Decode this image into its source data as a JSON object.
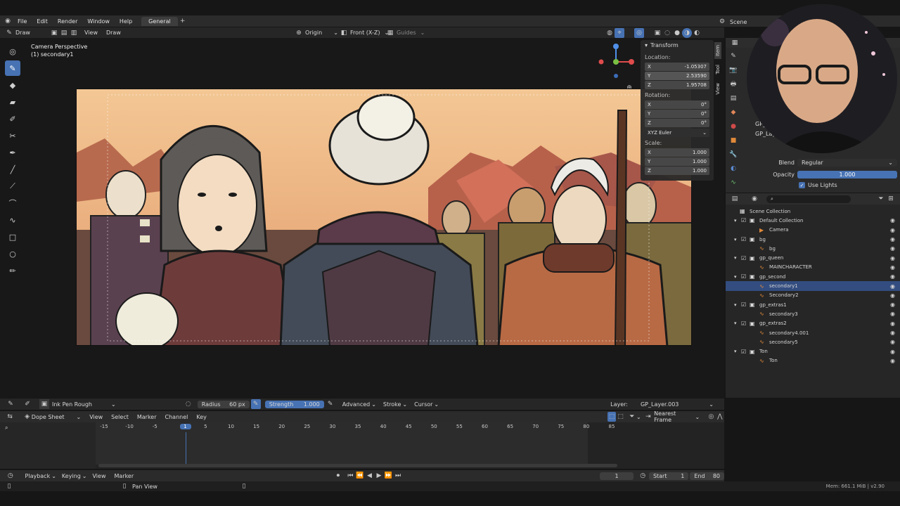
{
  "menu": {
    "items": [
      "File",
      "Edit",
      "Render",
      "Window",
      "Help"
    ],
    "workspace_tab": "General",
    "scene": "Scene"
  },
  "header": {
    "mode": "Draw",
    "view": "View",
    "draw": "Draw",
    "origin": "Origin",
    "front": "Front (X-Z)",
    "guides": "Guides"
  },
  "viewport": {
    "camera_title": "Camera Perspective",
    "object_name": "(1) secondary1"
  },
  "transform": {
    "title": "Transform",
    "location_label": "Location:",
    "loc": [
      {
        "axis": "X",
        "val": "-1.05307"
      },
      {
        "axis": "Y",
        "val": "2.53590"
      },
      {
        "axis": "Z",
        "val": "1.95708"
      }
    ],
    "rotation_label": "Rotation:",
    "rot": [
      {
        "axis": "X",
        "val": "0°"
      },
      {
        "axis": "Y",
        "val": "0°"
      },
      {
        "axis": "Z",
        "val": "0°"
      }
    ],
    "euler": "XYZ Euler",
    "scale_label": "Scale:",
    "scale": [
      {
        "axis": "X",
        "val": "1.000"
      },
      {
        "axis": "Y",
        "val": "1.000"
      },
      {
        "axis": "Z",
        "val": "1.000"
      }
    ],
    "tabs": [
      "Item",
      "Tool",
      "View"
    ]
  },
  "props": {
    "layer_short": "GP_",
    "layer_short2": "GP_Lay",
    "blend_label": "Blend",
    "blend_value": "Regular",
    "opacity_label": "Opacity",
    "opacity_value": "1.000",
    "opacity_level": 1.0,
    "use_lights": "Use Lights"
  },
  "outliner": {
    "rows": [
      {
        "label": "Scene Collection",
        "indent": 0,
        "type": "scene"
      },
      {
        "label": "Default Collection",
        "indent": 1,
        "type": "coll"
      },
      {
        "label": "Camera",
        "indent": 2,
        "type": "cam"
      },
      {
        "label": "bg",
        "indent": 1,
        "type": "coll"
      },
      {
        "label": "bg",
        "indent": 2,
        "type": "gp"
      },
      {
        "label": "gp_queen",
        "indent": 1,
        "type": "coll"
      },
      {
        "label": "MAINCHARACTER",
        "indent": 2,
        "type": "gp"
      },
      {
        "label": "gp_second",
        "indent": 1,
        "type": "coll"
      },
      {
        "label": "secondary1",
        "indent": 2,
        "type": "gp",
        "selected": true
      },
      {
        "label": "Secondary2",
        "indent": 2,
        "type": "gp"
      },
      {
        "label": "gp_extras1",
        "indent": 1,
        "type": "coll"
      },
      {
        "label": "secondary3",
        "indent": 2,
        "type": "gp"
      },
      {
        "label": "gp_extras2",
        "indent": 1,
        "type": "coll"
      },
      {
        "label": "secondary4.001",
        "indent": 2,
        "type": "gp"
      },
      {
        "label": "secondary5",
        "indent": 2,
        "type": "gp"
      },
      {
        "label": "Ton",
        "indent": 1,
        "type": "coll"
      },
      {
        "label": "Ton",
        "indent": 2,
        "type": "gp"
      }
    ]
  },
  "toolsettings": {
    "brush": "Ink Pen Rough",
    "radius_label": "Radius",
    "radius_value": "60 px",
    "strength_label": "Strength",
    "strength_value": "1.000",
    "advanced": "Advanced",
    "stroke": "Stroke",
    "cursor": "Cursor",
    "layer_label": "Layer:",
    "layer_value": "GP_Layer.003"
  },
  "dopesheet": {
    "editor": "Dope Sheet",
    "view": "View",
    "select": "Select",
    "marker": "Marker",
    "channel": "Channel",
    "key": "Key",
    "snap": "Nearest Frame",
    "ticks": [
      "-15",
      "-10",
      "-5",
      "1",
      "5",
      "10",
      "15",
      "20",
      "25",
      "30",
      "35",
      "40",
      "45",
      "50",
      "55",
      "60",
      "65",
      "70",
      "75",
      "80",
      "85"
    ],
    "current_frame": "1"
  },
  "playback": {
    "playback": "Playback",
    "keying": "Keying",
    "view": "View",
    "marker": "Marker",
    "frame": "1",
    "start_label": "Start",
    "start_value": "1",
    "end_label": "End",
    "end_value": "80"
  },
  "status": {
    "hint": "Pan View",
    "mem": "Mem: 661.1 MiB | v2.90"
  },
  "colors": {
    "accent": "#4772b3",
    "selected_row": "#334d80",
    "sky_top": "#f1c28e",
    "sky_bottom": "#e29a6a"
  }
}
